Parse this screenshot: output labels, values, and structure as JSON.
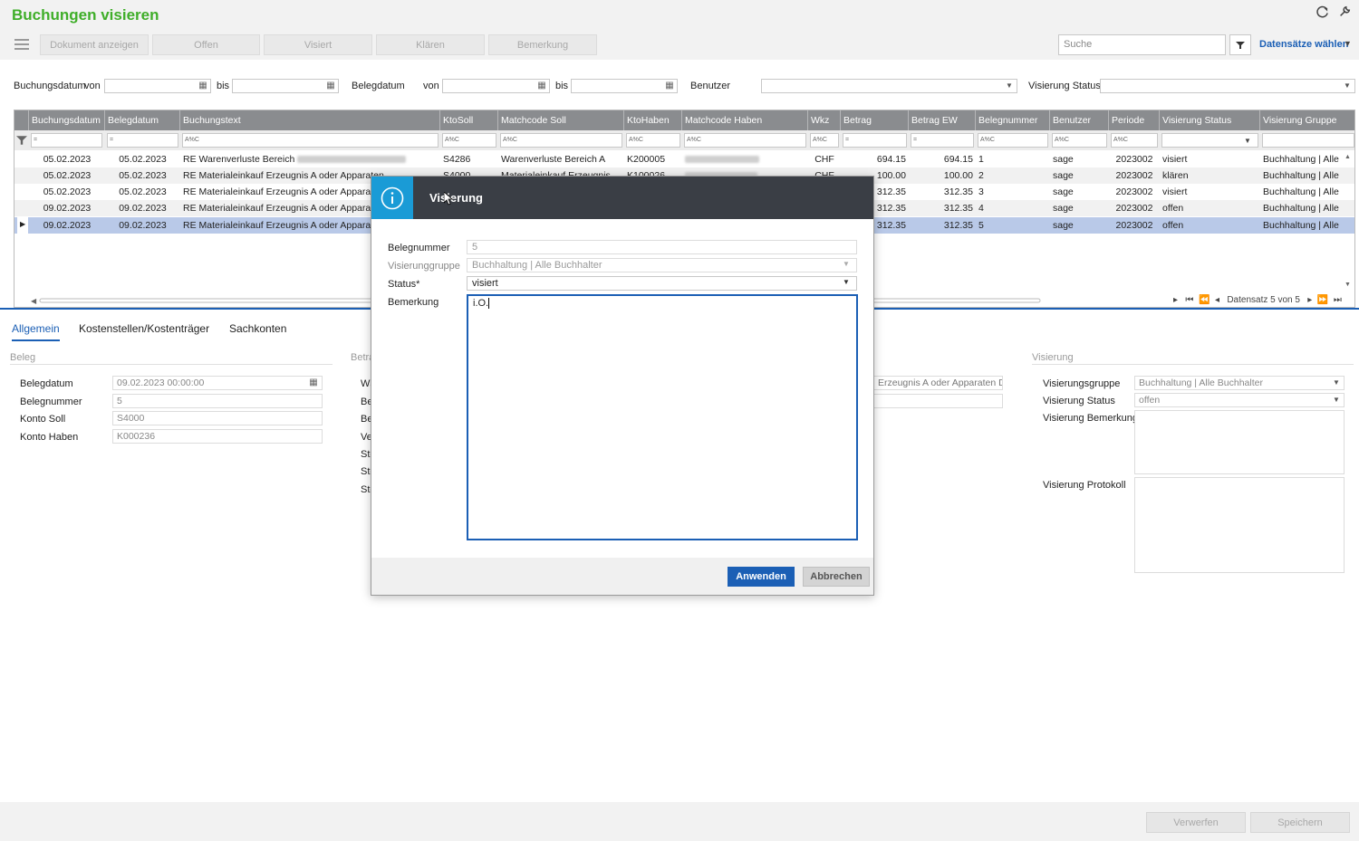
{
  "app": {
    "title": "Buchungen visieren"
  },
  "toolbar": {
    "buttons": [
      "Dokument anzeigen",
      "Offen",
      "Visiert",
      "Klären",
      "Bemerkung"
    ],
    "search_placeholder": "Suche",
    "datensaetze_label": "Datensätze wählen"
  },
  "filters": {
    "buchungsdatum": "Buchungsdatum",
    "von": "von",
    "bis": "bis",
    "belegdatum": "Belegdatum",
    "benutzer": "Benutzer",
    "visierung_status": "Visierung Status"
  },
  "grid": {
    "columns": [
      "Buchungsdatum",
      "Belegdatum",
      "Buchungstext",
      "KtoSoll",
      "Matchcode Soll",
      "KtoHaben",
      "Matchcode Haben",
      "Wkz",
      "Betrag",
      "Betrag EW",
      "Belegnummer",
      "Benutzer",
      "Periode",
      "Visierung Status",
      "Visierung Gruppe"
    ],
    "filter_eq": "=",
    "filter_txt": "A%C",
    "rows": [
      {
        "buchungsdatum": "05.02.2023",
        "belegdatum": "05.02.2023",
        "buchungstext": "RE Warenverluste Bereich",
        "ktosoll": "S4286",
        "matchcode_soll": "Warenverluste Bereich A",
        "ktohaben": "K200005",
        "wkz": "CHF",
        "betrag": "694.15",
        "betrag_ew": "694.15",
        "belegnummer": "1",
        "benutzer": "sage",
        "periode": "2023002",
        "status": "visiert",
        "gruppe": "Buchhaltung | Alle"
      },
      {
        "buchungsdatum": "05.02.2023",
        "belegdatum": "05.02.2023",
        "buchungstext": "RE Materialeinkauf Erzeugnis A oder Apparaten",
        "ktosoll": "S4000",
        "matchcode_soll": "Materialeinkauf Erzeugnis",
        "ktohaben": "K100026",
        "wkz": "CHF",
        "betrag": "100.00",
        "betrag_ew": "100.00",
        "belegnummer": "2",
        "benutzer": "sage",
        "periode": "2023002",
        "status": "klären",
        "gruppe": "Buchhaltung | Alle"
      },
      {
        "buchungsdatum": "05.02.2023",
        "belegdatum": "05.02.2023",
        "buchungstext": "RE Materialeinkauf Erzeugnis A oder Apparaten",
        "ktosoll": "",
        "matchcode_soll": "",
        "ktohaben": "",
        "wkz": "",
        "betrag": "312.35",
        "betrag_ew": "312.35",
        "belegnummer": "3",
        "benutzer": "sage",
        "periode": "2023002",
        "status": "visiert",
        "gruppe": "Buchhaltung | Alle"
      },
      {
        "buchungsdatum": "09.02.2023",
        "belegdatum": "09.02.2023",
        "buchungstext": "RE Materialeinkauf Erzeugnis A oder Apparaten",
        "ktosoll": "",
        "matchcode_soll": "",
        "ktohaben": "",
        "wkz": "",
        "betrag": "312.35",
        "betrag_ew": "312.35",
        "belegnummer": "4",
        "benutzer": "sage",
        "periode": "2023002",
        "status": "offen",
        "gruppe": "Buchhaltung | Alle"
      },
      {
        "buchungsdatum": "09.02.2023",
        "belegdatum": "09.02.2023",
        "buchungstext": "RE Materialeinkauf Erzeugnis A oder Apparaten",
        "ktosoll": "",
        "matchcode_soll": "",
        "ktohaben": "",
        "wkz": "",
        "betrag": "312.35",
        "betrag_ew": "312.35",
        "belegnummer": "5",
        "benutzer": "sage",
        "periode": "2023002",
        "status": "offen",
        "gruppe": "Buchhaltung | Alle"
      }
    ],
    "record_nav": "Datensatz 5 von 5"
  },
  "tabs": [
    "Allgemein",
    "Kostenstellen/Kostenträger",
    "Sachkonten"
  ],
  "detail": {
    "beleg_section": "Beleg",
    "betrag_section": "Betra",
    "visierung_section": "Visierung",
    "belegdatum_label": "Belegdatum",
    "belegdatum_value": "09.02.2023 00:00:00",
    "belegnummer_label": "Belegnummer",
    "belegnummer_value": "5",
    "konto_soll_label": "Konto Soll",
    "konto_soll_value": "S4000",
    "konto_haben_label": "Konto Haben",
    "konto_haben_value": "K000236",
    "mid_labels": [
      "Wä",
      "Be",
      "Be",
      "Ve",
      "Ste",
      "Ste",
      "Ste"
    ],
    "mid_text_value": "Erzeugnis A oder Apparaten D",
    "visierungsgruppe_label": "Visierungsgruppe",
    "visierungsgruppe_value": "Buchhaltung  |  Alle Buchhalter",
    "visierung_status_label": "Visierung Status",
    "visierung_status_value": "offen",
    "visierung_bemerkung_label": "Visierung Bemerkung",
    "visierung_protokoll_label": "Visierung Protokoll"
  },
  "footer": {
    "verwerfen": "Verwerfen",
    "speichern": "Speichern"
  },
  "modal": {
    "title": "Visierung",
    "belegnummer_label": "Belegnummer",
    "belegnummer_value": "5",
    "visierungsgruppe_label": "Visierunggruppe",
    "visierungsgruppe_value": "Buchhaltung  |  Alle Buchhalter",
    "status_label": "Status*",
    "status_value": "visiert",
    "bemerkung_label": "Bemerkung",
    "bemerkung_value": "i.O.",
    "apply": "Anwenden",
    "cancel": "Abbrechen"
  },
  "colors": {
    "title_green": "#3fae29",
    "accent_blue": "#1b5fb5",
    "modal_icon_blue": "#1a9bd6",
    "modal_header": "#3a3e45",
    "selected_row": "#b9c9e8"
  }
}
